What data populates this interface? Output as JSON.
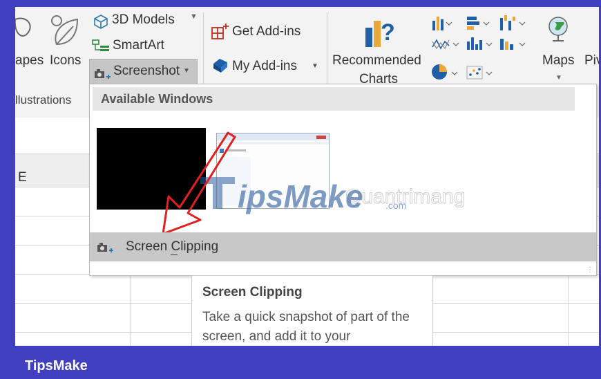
{
  "ribbon": {
    "shapes_label": "apes",
    "icons_label": "Icons",
    "group_label": "llustrations",
    "models_label": "3D Models",
    "smartart_label": "SmartArt",
    "screenshot_label": "Screenshot",
    "get_addins_label": "Get Add-ins",
    "my_addins_label": "My Add-ins",
    "recommended_line1": "Recommended",
    "recommended_line2": "Charts",
    "maps_label": "Maps",
    "pivot_label": "Piv"
  },
  "sheet": {
    "column_header": "E"
  },
  "dropdown": {
    "header": "Available Windows",
    "clipping_label": "Screen Clipping"
  },
  "tooltip": {
    "title": "Screen Clipping",
    "body": "Take a quick snapshot of part of the screen, and add it to your"
  },
  "watermark": {
    "main": "ipsMake",
    "suffix": ".com",
    "ghost": "Quantrimang"
  },
  "footer": {
    "brand": "TipsMake"
  },
  "colors": {
    "frame": "#3f3fbf",
    "highlight": "#c8c8c8",
    "arrow": "#e02020"
  }
}
